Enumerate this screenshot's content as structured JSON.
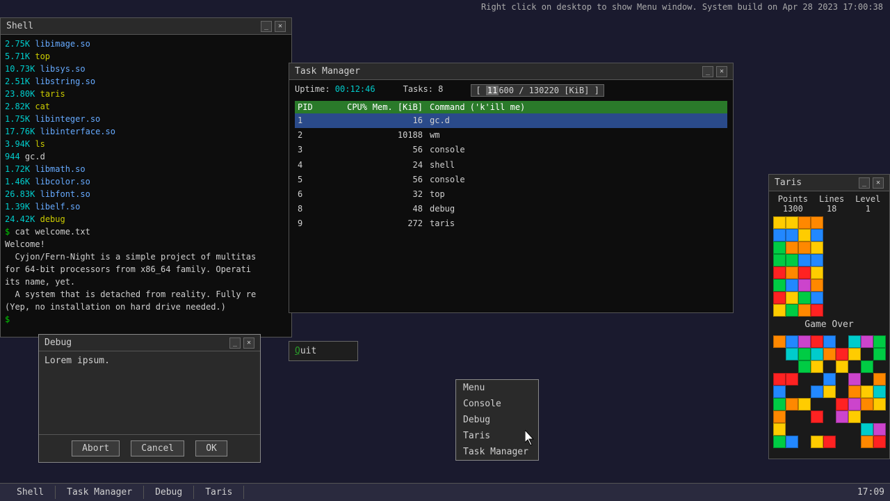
{
  "topbar": {
    "text": "Right click on desktop to show Menu window. System build on Apr 28 2023 17:00:38"
  },
  "shell": {
    "title": "Shell",
    "files": [
      {
        "size": "2.75K",
        "name": "libimage.so"
      },
      {
        "size": "5.71K",
        "name": "top"
      },
      {
        "size": "10.73K",
        "name": "libsys.so"
      },
      {
        "size": "2.51K",
        "name": "libstring.so"
      },
      {
        "size": "23.80K",
        "name": "taris"
      },
      {
        "size": "2.82K",
        "name": "cat"
      },
      {
        "size": "1.75K",
        "name": "libinteger.so"
      },
      {
        "size": "17.76K",
        "name": "libinterface.so"
      },
      {
        "size": "3.94K",
        "name": "ls"
      },
      {
        "size": "944",
        "name": "gc.d"
      },
      {
        "size": "1.72K",
        "name": "libmath.so"
      },
      {
        "size": "1.46K",
        "name": "libcolor.so"
      },
      {
        "size": "26.83K",
        "name": "libfont.so"
      },
      {
        "size": "1.39K",
        "name": "libelf.so"
      },
      {
        "size": "24.42K",
        "name": "debug"
      }
    ],
    "cmd1": "$ cat welcome.txt",
    "welcome": "Welcome!",
    "line1": "  Cyjon/Fern-Night is a simple project of multitas",
    "line2": "for 64-bit processors from x86_64 family. Operati",
    "line3": "its name, yet.",
    "line4": "  A system that is detached from reality. Fully re",
    "line5": "(Yep, no installation on hard drive needed.)",
    "prompt": "$ "
  },
  "task_manager": {
    "title": "Task Manager",
    "uptime_label": "Uptime:",
    "uptime_value": "00:12:46",
    "tasks_label": "Tasks:",
    "tasks_value": "8",
    "mem_used": "11600",
    "mem_total": "130220",
    "mem_unit": "[KiB]",
    "header": {
      "pid": "PID",
      "cpu": "CPU%",
      "mem": "Mem. [KiB]",
      "cmd": "Command ('k'ill me)"
    },
    "rows": [
      {
        "pid": "1",
        "cpu": "",
        "mem": "16",
        "cmd": "gc.d",
        "selected": true
      },
      {
        "pid": "2",
        "cpu": "",
        "mem": "10188",
        "cmd": "wm",
        "selected": false
      },
      {
        "pid": "3",
        "cpu": "",
        "mem": "56",
        "cmd": "console",
        "selected": false
      },
      {
        "pid": "4",
        "cpu": "",
        "mem": "24",
        "cmd": "shell",
        "selected": false
      },
      {
        "pid": "5",
        "cpu": "",
        "mem": "56",
        "cmd": "console",
        "selected": false
      },
      {
        "pid": "6",
        "cpu": "",
        "mem": "32",
        "cmd": "top",
        "selected": false
      },
      {
        "pid": "8",
        "cpu": "",
        "mem": "48",
        "cmd": "debug",
        "selected": false
      },
      {
        "pid": "9",
        "cpu": "",
        "mem": "272",
        "cmd": "taris",
        "selected": false
      }
    ]
  },
  "taris": {
    "title": "Taris",
    "points_label": "Points",
    "points_value": "1300",
    "lines_label": "Lines",
    "lines_value": "18",
    "level_label": "Level",
    "level_value": "1",
    "game_over": "Game Over"
  },
  "debug": {
    "title": "Debug",
    "text": "Lorem ipsum.",
    "btn_abort": "Abort",
    "btn_cancel": "Cancel",
    "btn_ok": "OK"
  },
  "context_menu": {
    "items": [
      "Menu",
      "Console",
      "Debug",
      "Taris",
      "Task Manager"
    ]
  },
  "quit_menu": {
    "text": "Quit"
  },
  "taskbar": {
    "items": [
      "Shell",
      "Task Manager",
      "Debug",
      "Taris"
    ],
    "time": "17:09"
  }
}
